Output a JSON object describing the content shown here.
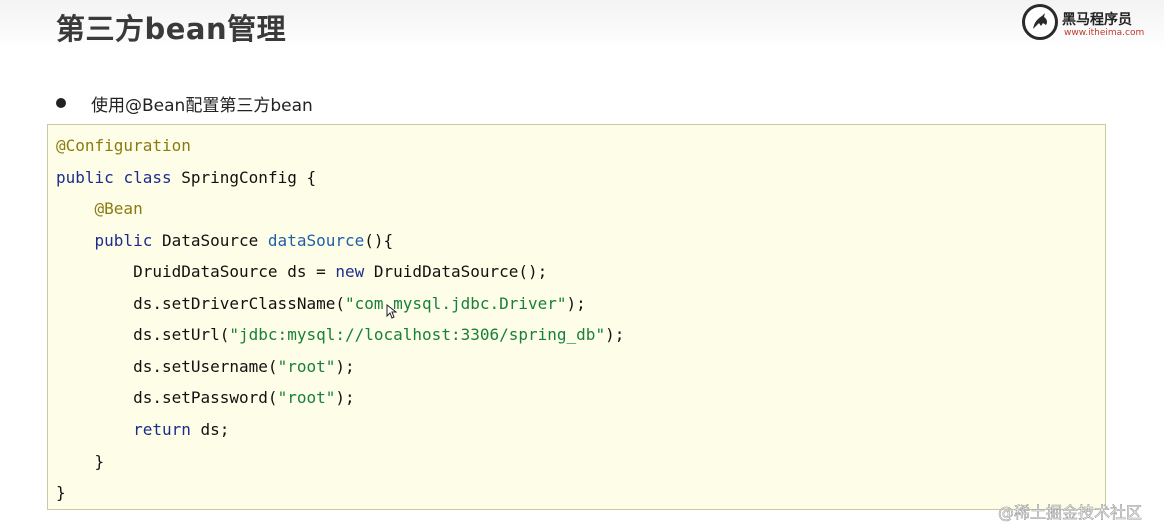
{
  "slide": {
    "title": "第三方bean管理"
  },
  "logo": {
    "name": "黑马程序员",
    "url": "www.itheima.com",
    "icon": "horse-logo-icon"
  },
  "bullet": {
    "text": "使用@Bean配置第三方bean"
  },
  "code": {
    "line1": {
      "ann": "@Configuration"
    },
    "line2": {
      "kw1": "public",
      "kw2": "class",
      "rest": " SpringConfig {"
    },
    "line3": {
      "ann": "@Bean"
    },
    "line4": {
      "kw1": "public",
      "type": " DataSource ",
      "method": "dataSource",
      "rest": "(){"
    },
    "line5": {
      "pre": "DruidDataSource ds = ",
      "kw": "new",
      "post": " DruidDataSource();"
    },
    "line6": {
      "pre": "ds.setDriverClassName(",
      "str": "\"com.mysql.jdbc.Driver\"",
      "post": ");"
    },
    "line7": {
      "pre": "ds.setUrl(",
      "str": "\"jdbc:mysql://localhost:3306/spring_db\"",
      "post": ");"
    },
    "line8": {
      "pre": "ds.setUsername(",
      "str": "\"root\"",
      "post": ");"
    },
    "line9": {
      "pre": "ds.setPassword(",
      "str": "\"root\"",
      "post": ");"
    },
    "line10": {
      "kw": "return",
      "post": " ds;"
    },
    "line11": {
      "text": "}"
    },
    "line12": {
      "text": "}"
    }
  },
  "watermark": {
    "text": "@稀土掘金技术社区"
  },
  "colors": {
    "annotation": "#8b7a12",
    "keyword": "#1c2c8c",
    "string": "#17803a",
    "method": "#1f5fa8",
    "panel_bg": "#fefee8"
  }
}
